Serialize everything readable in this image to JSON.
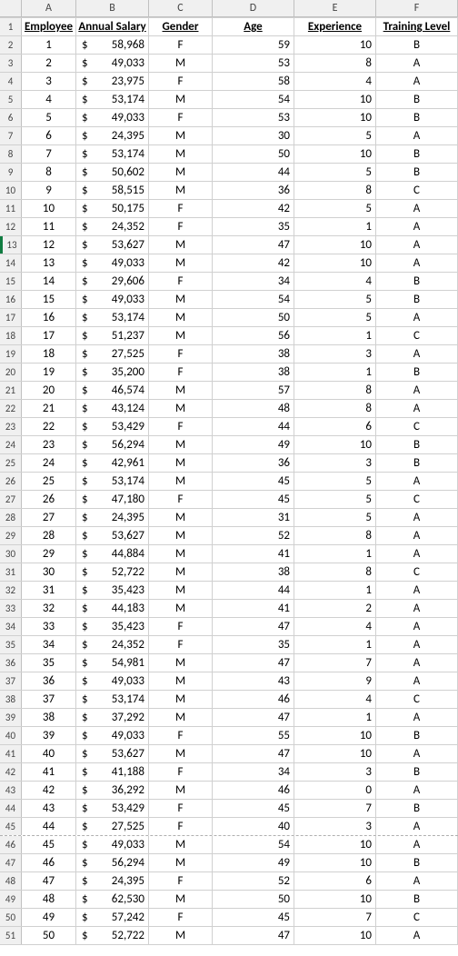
{
  "columns": [
    "A",
    "B",
    "C",
    "D",
    "E",
    "F"
  ],
  "headers": {
    "employee": "Employee",
    "salary": "Annual Salary",
    "gender": "Gender",
    "age": "Age",
    "experience": "Experience",
    "training": "Training Level"
  },
  "selected_row_sheet_index": 13,
  "dashed_after_sheet_row": 45,
  "chart_data": {
    "type": "table",
    "columns": [
      "Employee",
      "Annual Salary",
      "Gender",
      "Age",
      "Experience",
      "Training Level"
    ],
    "rows": [
      {
        "employee": 1,
        "salary": 58968,
        "gender": "F",
        "age": 59,
        "experience": 10,
        "training": "B"
      },
      {
        "employee": 2,
        "salary": 49033,
        "gender": "M",
        "age": 53,
        "experience": 8,
        "training": "A"
      },
      {
        "employee": 3,
        "salary": 23975,
        "gender": "F",
        "age": 58,
        "experience": 4,
        "training": "A"
      },
      {
        "employee": 4,
        "salary": 53174,
        "gender": "M",
        "age": 54,
        "experience": 10,
        "training": "B"
      },
      {
        "employee": 5,
        "salary": 49033,
        "gender": "F",
        "age": 53,
        "experience": 10,
        "training": "B"
      },
      {
        "employee": 6,
        "salary": 24395,
        "gender": "M",
        "age": 30,
        "experience": 5,
        "training": "A"
      },
      {
        "employee": 7,
        "salary": 53174,
        "gender": "M",
        "age": 50,
        "experience": 10,
        "training": "B"
      },
      {
        "employee": 8,
        "salary": 50602,
        "gender": "M",
        "age": 44,
        "experience": 5,
        "training": "B"
      },
      {
        "employee": 9,
        "salary": 58515,
        "gender": "M",
        "age": 36,
        "experience": 8,
        "training": "C"
      },
      {
        "employee": 10,
        "salary": 50175,
        "gender": "F",
        "age": 42,
        "experience": 5,
        "training": "A"
      },
      {
        "employee": 11,
        "salary": 24352,
        "gender": "F",
        "age": 35,
        "experience": 1,
        "training": "A"
      },
      {
        "employee": 12,
        "salary": 53627,
        "gender": "M",
        "age": 47,
        "experience": 10,
        "training": "A"
      },
      {
        "employee": 13,
        "salary": 49033,
        "gender": "M",
        "age": 42,
        "experience": 10,
        "training": "A"
      },
      {
        "employee": 14,
        "salary": 29606,
        "gender": "F",
        "age": 34,
        "experience": 4,
        "training": "B"
      },
      {
        "employee": 15,
        "salary": 49033,
        "gender": "M",
        "age": 54,
        "experience": 5,
        "training": "B"
      },
      {
        "employee": 16,
        "salary": 53174,
        "gender": "M",
        "age": 50,
        "experience": 5,
        "training": "A"
      },
      {
        "employee": 17,
        "salary": 51237,
        "gender": "M",
        "age": 56,
        "experience": 1,
        "training": "C"
      },
      {
        "employee": 18,
        "salary": 27525,
        "gender": "F",
        "age": 38,
        "experience": 3,
        "training": "A"
      },
      {
        "employee": 19,
        "salary": 35200,
        "gender": "F",
        "age": 38,
        "experience": 1,
        "training": "B"
      },
      {
        "employee": 20,
        "salary": 46574,
        "gender": "M",
        "age": 57,
        "experience": 8,
        "training": "A"
      },
      {
        "employee": 21,
        "salary": 43124,
        "gender": "M",
        "age": 48,
        "experience": 8,
        "training": "A"
      },
      {
        "employee": 22,
        "salary": 53429,
        "gender": "F",
        "age": 44,
        "experience": 6,
        "training": "C"
      },
      {
        "employee": 23,
        "salary": 56294,
        "gender": "M",
        "age": 49,
        "experience": 10,
        "training": "B"
      },
      {
        "employee": 24,
        "salary": 42961,
        "gender": "M",
        "age": 36,
        "experience": 3,
        "training": "B"
      },
      {
        "employee": 25,
        "salary": 53174,
        "gender": "M",
        "age": 45,
        "experience": 5,
        "training": "A"
      },
      {
        "employee": 26,
        "salary": 47180,
        "gender": "F",
        "age": 45,
        "experience": 5,
        "training": "C"
      },
      {
        "employee": 27,
        "salary": 24395,
        "gender": "M",
        "age": 31,
        "experience": 5,
        "training": "A"
      },
      {
        "employee": 28,
        "salary": 53627,
        "gender": "M",
        "age": 52,
        "experience": 8,
        "training": "A"
      },
      {
        "employee": 29,
        "salary": 44884,
        "gender": "M",
        "age": 41,
        "experience": 1,
        "training": "A"
      },
      {
        "employee": 30,
        "salary": 52722,
        "gender": "M",
        "age": 38,
        "experience": 8,
        "training": "C"
      },
      {
        "employee": 31,
        "salary": 35423,
        "gender": "M",
        "age": 44,
        "experience": 1,
        "training": "A"
      },
      {
        "employee": 32,
        "salary": 44183,
        "gender": "M",
        "age": 41,
        "experience": 2,
        "training": "A"
      },
      {
        "employee": 33,
        "salary": 35423,
        "gender": "F",
        "age": 47,
        "experience": 4,
        "training": "A"
      },
      {
        "employee": 34,
        "salary": 24352,
        "gender": "F",
        "age": 35,
        "experience": 1,
        "training": "A"
      },
      {
        "employee": 35,
        "salary": 54981,
        "gender": "M",
        "age": 47,
        "experience": 7,
        "training": "A"
      },
      {
        "employee": 36,
        "salary": 49033,
        "gender": "M",
        "age": 43,
        "experience": 9,
        "training": "A"
      },
      {
        "employee": 37,
        "salary": 53174,
        "gender": "M",
        "age": 46,
        "experience": 4,
        "training": "C"
      },
      {
        "employee": 38,
        "salary": 37292,
        "gender": "M",
        "age": 47,
        "experience": 1,
        "training": "A"
      },
      {
        "employee": 39,
        "salary": 49033,
        "gender": "F",
        "age": 55,
        "experience": 10,
        "training": "B"
      },
      {
        "employee": 40,
        "salary": 53627,
        "gender": "M",
        "age": 47,
        "experience": 10,
        "training": "A"
      },
      {
        "employee": 41,
        "salary": 41188,
        "gender": "F",
        "age": 34,
        "experience": 3,
        "training": "B"
      },
      {
        "employee": 42,
        "salary": 36292,
        "gender": "M",
        "age": 46,
        "experience": 0,
        "training": "A"
      },
      {
        "employee": 43,
        "salary": 53429,
        "gender": "F",
        "age": 45,
        "experience": 7,
        "training": "B"
      },
      {
        "employee": 44,
        "salary": 27525,
        "gender": "F",
        "age": 40,
        "experience": 3,
        "training": "A"
      },
      {
        "employee": 45,
        "salary": 49033,
        "gender": "M",
        "age": 54,
        "experience": 10,
        "training": "A"
      },
      {
        "employee": 46,
        "salary": 56294,
        "gender": "M",
        "age": 49,
        "experience": 10,
        "training": "B"
      },
      {
        "employee": 47,
        "salary": 24395,
        "gender": "F",
        "age": 52,
        "experience": 6,
        "training": "A"
      },
      {
        "employee": 48,
        "salary": 62530,
        "gender": "M",
        "age": 50,
        "experience": 10,
        "training": "B"
      },
      {
        "employee": 49,
        "salary": 57242,
        "gender": "F",
        "age": 45,
        "experience": 7,
        "training": "C"
      },
      {
        "employee": 50,
        "salary": 52722,
        "gender": "M",
        "age": 47,
        "experience": 10,
        "training": "A"
      }
    ]
  }
}
